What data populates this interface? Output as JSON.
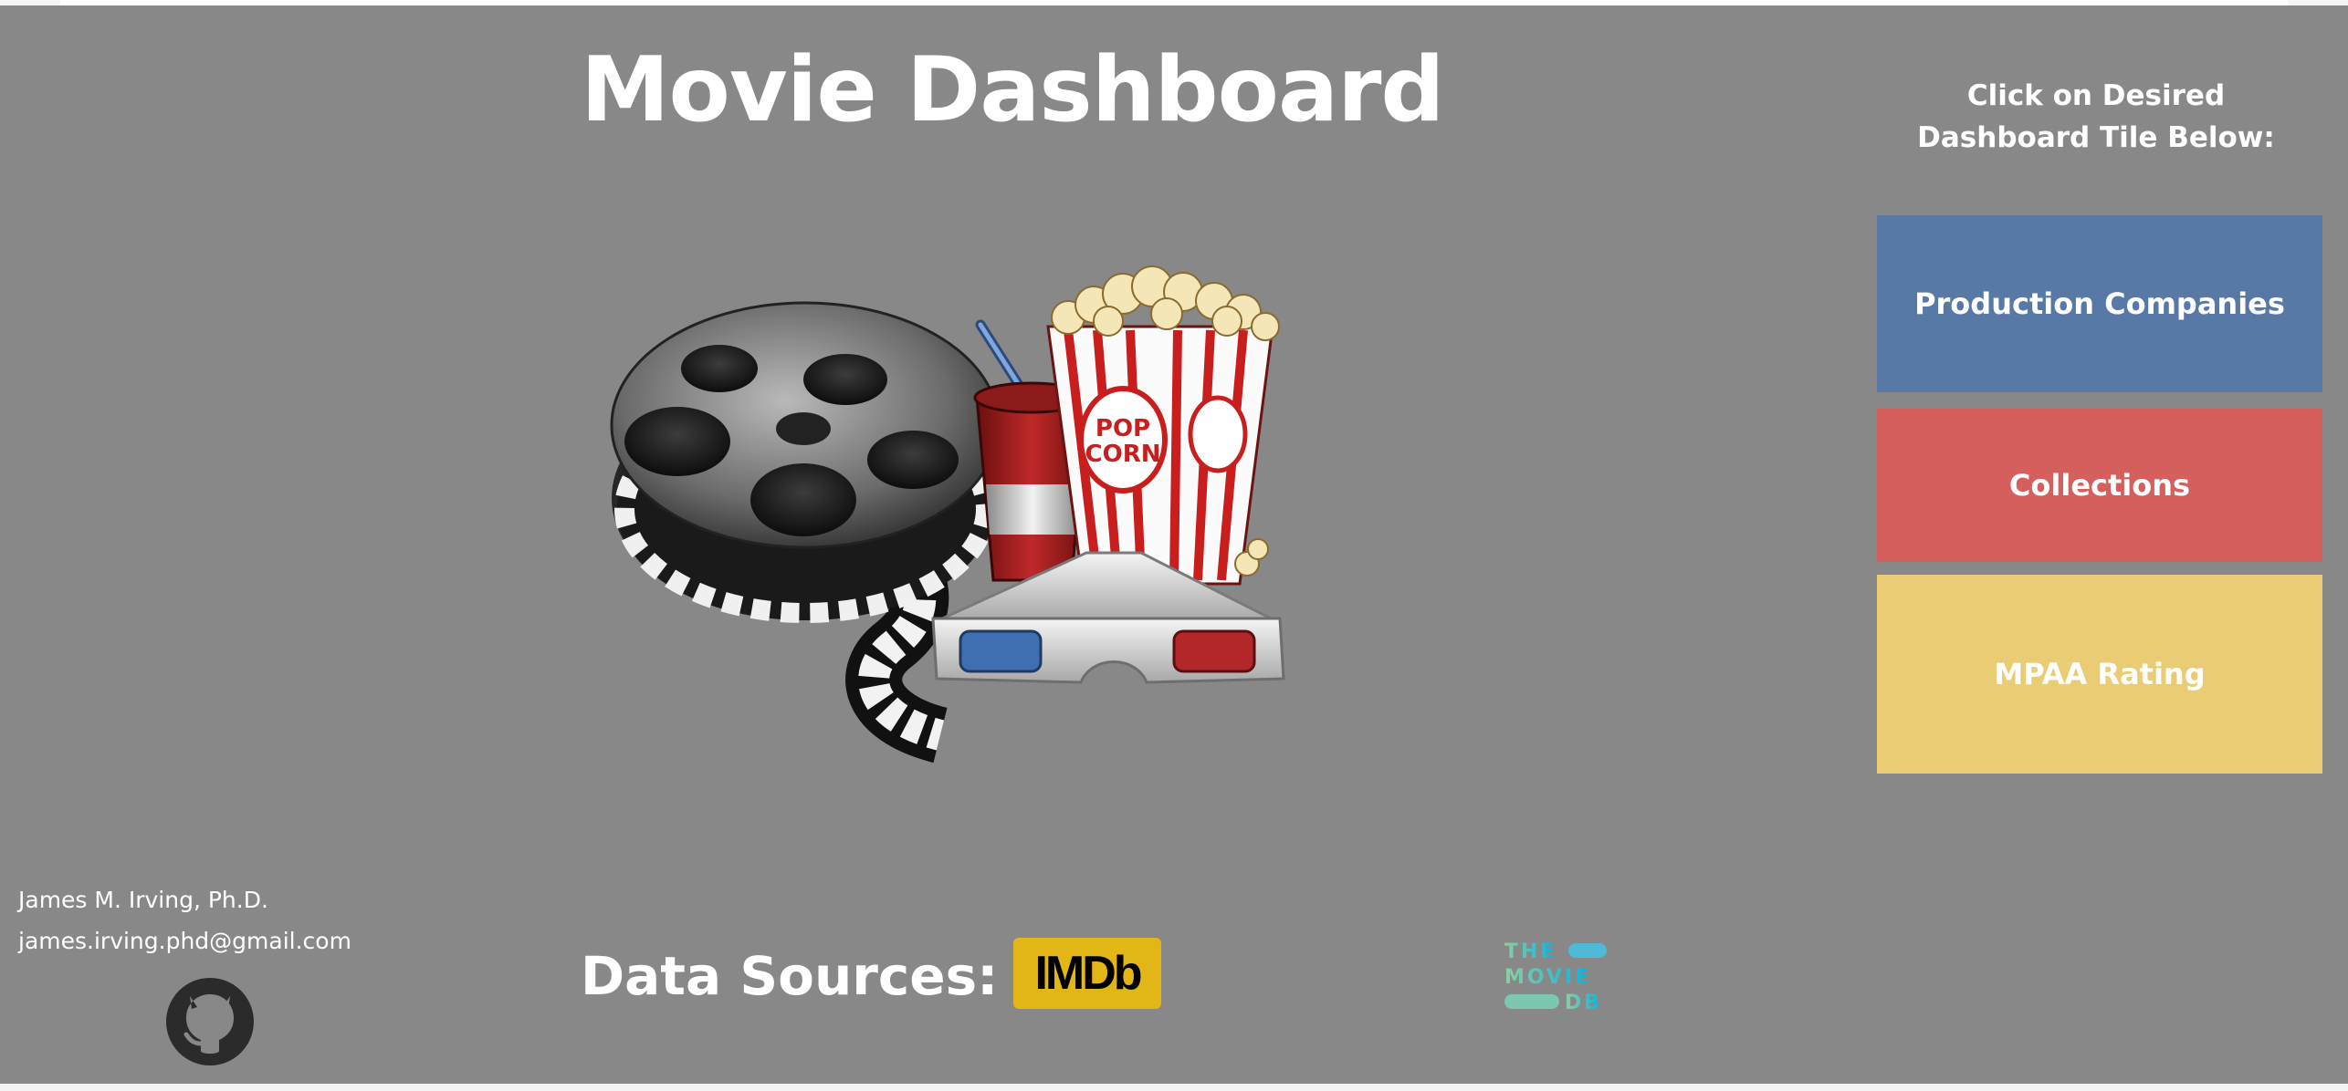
{
  "dashboard": {
    "title": "Movie Dashboard",
    "instruction": "Click on Desired\nDashboard Tile Below:",
    "tiles": [
      {
        "label": "Production Companies",
        "color": "#5878a6"
      },
      {
        "label": "Collections",
        "color": "#d45f5c"
      },
      {
        "label": "MPAA Rating",
        "color": "#e9cc73"
      }
    ],
    "hero_image": "film-reel-popcorn-soda-3d-glasses-illustration"
  },
  "author": {
    "name": "James M. Irving, Ph.D.",
    "email": "james.irving.phd@gmail.com",
    "github_icon": "github-icon"
  },
  "data_sources": {
    "label": "Data Sources:",
    "imdb_logo_text": "IMDb",
    "tmdb_logo_lines": [
      "THE",
      "MOVIE",
      "DB"
    ]
  },
  "colors": {
    "background": "#888888",
    "text": "#ffffff",
    "imdb_yellow": "#e2b616",
    "tmdb_teal": "#90cea1",
    "tmdb_blue": "#01b4e4"
  }
}
